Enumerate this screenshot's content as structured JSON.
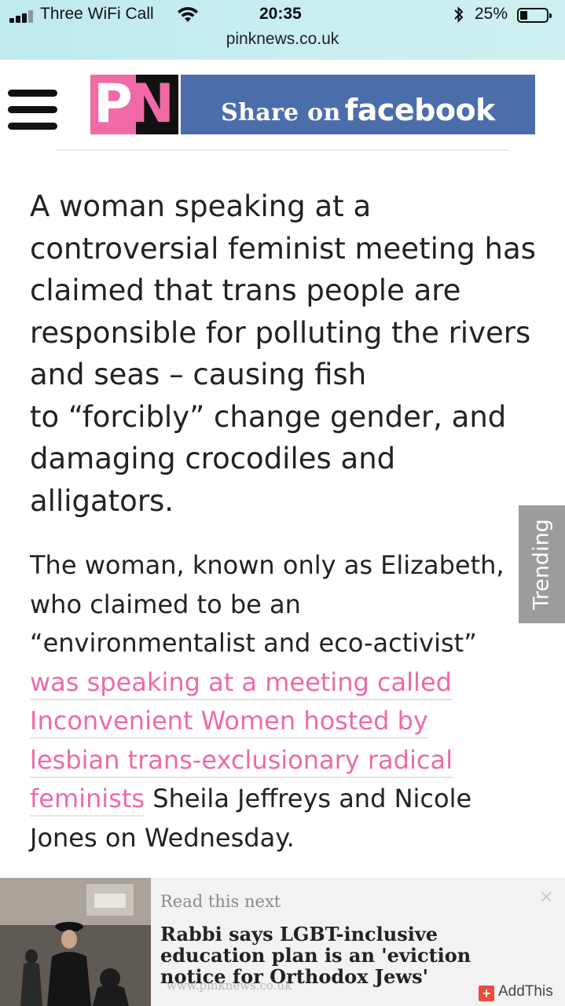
{
  "status_bar": {
    "carrier": "Three WiFi Call",
    "time": "20:35",
    "battery_percent": "25%",
    "battery_level": 0.25,
    "url": "pinknews.co.uk",
    "icons": [
      "signal-icon",
      "wifi-icon",
      "bluetooth-icon",
      "battery-icon"
    ]
  },
  "header": {
    "menu_icon": "hamburger-menu-icon",
    "logo": "PN",
    "facebook_button": {
      "prefix": "Share on",
      "brand": "facebook"
    },
    "colors": {
      "brand_pink": "#f06aa5",
      "facebook_blue": "#4b6eab"
    }
  },
  "article": {
    "paragraph1_lines": [
      "A woman speaking at a",
      "controversial feminist meeting has",
      "claimed that trans people are",
      "responsible for polluting the rivers",
      "and seas – causing fish",
      "to “forcibly” change gender, and",
      "damaging crocodiles and",
      "alligators."
    ],
    "paragraph2": {
      "line1": "The woman, known only as Elizabeth,",
      "line2": "who claimed to be an",
      "line3": "“environmentalist and eco-activist”",
      "link_line1": "was speaking at a meeting called",
      "link_line2": "Inconvenient Women hosted by",
      "link_line3": "lesbian trans-exclusionary radical",
      "link_line4": "feminists",
      "line7_rest": " Sheila Jeffreys and Nicole",
      "line8": "Jones on Wednesday."
    },
    "link_color": "#ee6aa9"
  },
  "trending_tab": {
    "label": "Trending"
  },
  "read_next": {
    "label": "Read this next",
    "title": "Rabbi says LGBT-inclusive education plan is an 'eviction notice for Orthodox Jews'",
    "source": "www.pinknews.co.uk",
    "close": "×",
    "addthis": {
      "icon": "+",
      "label": "AddThis"
    }
  }
}
